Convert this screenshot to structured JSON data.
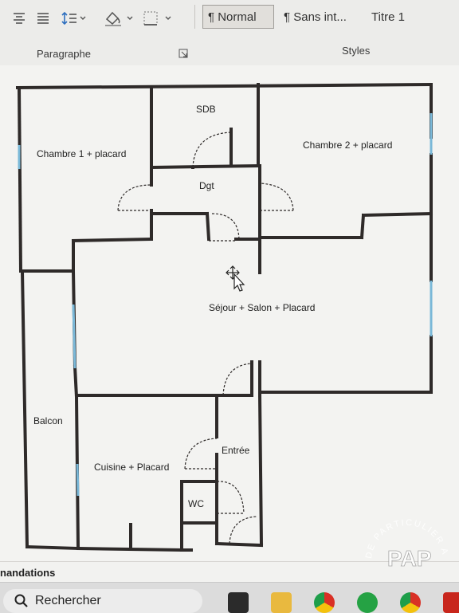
{
  "ribbon": {
    "paragraph_group_label": "Paragraphe",
    "styles_group_label": "Styles",
    "styles": [
      {
        "label": "¶ Normal",
        "selected": true
      },
      {
        "label": "¶ Sans int...",
        "selected": false
      },
      {
        "label": "Titre 1",
        "selected": false
      }
    ]
  },
  "floor_plan": {
    "rooms": {
      "chambre1": "Chambre 1 + placard",
      "sdb": "SDB",
      "chambre2": "Chambre 2 + placard",
      "dgt": "Dgt",
      "sejour": "Séjour + Salon + Placard",
      "balcon": "Balcon",
      "entree": "Entrée",
      "cuisine": "Cuisine + Placard",
      "wc": "WC"
    },
    "wall_color": "#2e2a29",
    "window_color": "#7ab8d8"
  },
  "status_bar": {
    "text": "nandations"
  },
  "taskbar": {
    "search_placeholder": "Rechercher",
    "apps": [
      "file-explorer-icon",
      "folder-icon",
      "chrome-icon",
      "whatsapp-icon",
      "chrome-profile-icon",
      "acrobat-icon"
    ]
  },
  "watermark": {
    "logo": "PAP",
    "ring_text": "DE PARTICULIER A PARTICULIER"
  }
}
